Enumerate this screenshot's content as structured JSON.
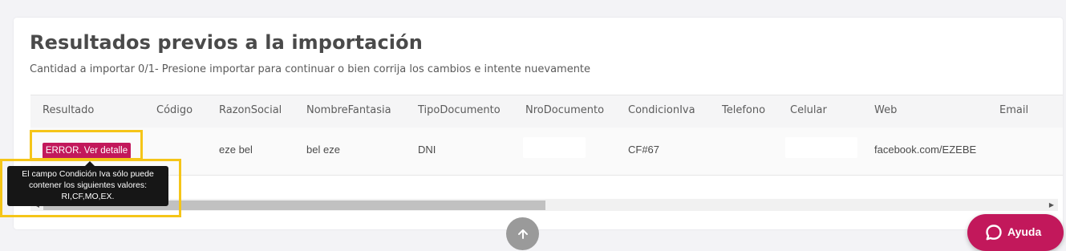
{
  "header": {
    "title": "Resultados previos a la importación",
    "subtitle": "Cantidad a importar 0/1- Presione importar para continuar o bien corrija los cambios e intente nuevamente"
  },
  "table": {
    "columns": [
      "Resultado",
      "Código",
      "RazonSocial",
      "NombreFantasia",
      "TipoDocumento",
      "NroDocumento",
      "CondicionIva",
      "Telefono",
      "Celular",
      "Web",
      "Email"
    ],
    "row": {
      "resultado": "ERROR. Ver detalle",
      "codigo": "",
      "razon_social": "eze bel",
      "nombre_fantasia": "bel eze",
      "tipo_documento": "DNI",
      "nro_documento": "",
      "condicion_iva": "CF#67",
      "telefono": "",
      "celular": "",
      "web": "facebook.com/EZEBE",
      "email": ""
    }
  },
  "tooltip": {
    "line1": "El campo Condición Iva sólo puede",
    "line2": "contener los siguientes valores:",
    "line3": "RI,CF,MO,EX."
  },
  "help_button": {
    "label": "Ayuda"
  },
  "colors": {
    "accent": "#c2185b",
    "highlight": "#f5c518",
    "tooltip_bg": "#161616"
  },
  "icons": {
    "scroll_up": "arrow-up-icon",
    "help": "chat-bubble-icon",
    "scroll_left": "triangle-left-icon",
    "scroll_right": "triangle-right-icon"
  }
}
